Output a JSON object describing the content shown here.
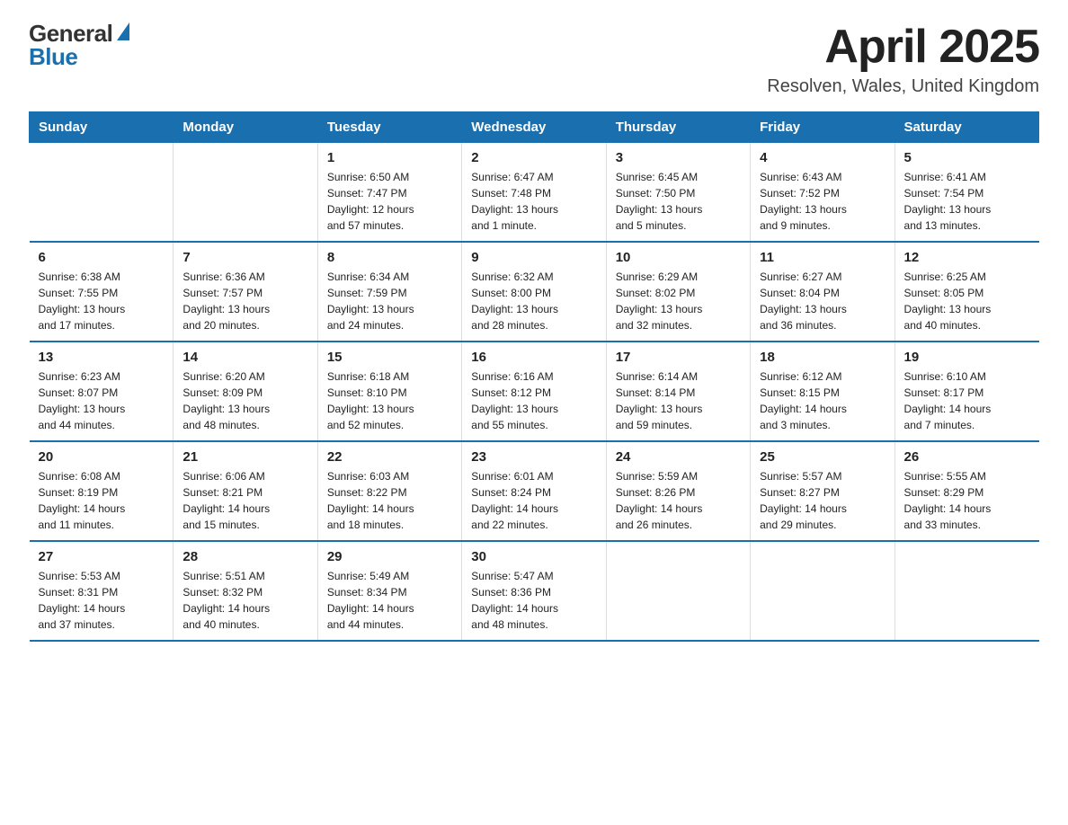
{
  "header": {
    "logo_general": "General",
    "logo_blue": "Blue",
    "month_title": "April 2025",
    "location": "Resolven, Wales, United Kingdom"
  },
  "weekdays": [
    "Sunday",
    "Monday",
    "Tuesday",
    "Wednesday",
    "Thursday",
    "Friday",
    "Saturday"
  ],
  "weeks": [
    [
      {
        "day": "",
        "info": ""
      },
      {
        "day": "",
        "info": ""
      },
      {
        "day": "1",
        "info": "Sunrise: 6:50 AM\nSunset: 7:47 PM\nDaylight: 12 hours\nand 57 minutes."
      },
      {
        "day": "2",
        "info": "Sunrise: 6:47 AM\nSunset: 7:48 PM\nDaylight: 13 hours\nand 1 minute."
      },
      {
        "day": "3",
        "info": "Sunrise: 6:45 AM\nSunset: 7:50 PM\nDaylight: 13 hours\nand 5 minutes."
      },
      {
        "day": "4",
        "info": "Sunrise: 6:43 AM\nSunset: 7:52 PM\nDaylight: 13 hours\nand 9 minutes."
      },
      {
        "day": "5",
        "info": "Sunrise: 6:41 AM\nSunset: 7:54 PM\nDaylight: 13 hours\nand 13 minutes."
      }
    ],
    [
      {
        "day": "6",
        "info": "Sunrise: 6:38 AM\nSunset: 7:55 PM\nDaylight: 13 hours\nand 17 minutes."
      },
      {
        "day": "7",
        "info": "Sunrise: 6:36 AM\nSunset: 7:57 PM\nDaylight: 13 hours\nand 20 minutes."
      },
      {
        "day": "8",
        "info": "Sunrise: 6:34 AM\nSunset: 7:59 PM\nDaylight: 13 hours\nand 24 minutes."
      },
      {
        "day": "9",
        "info": "Sunrise: 6:32 AM\nSunset: 8:00 PM\nDaylight: 13 hours\nand 28 minutes."
      },
      {
        "day": "10",
        "info": "Sunrise: 6:29 AM\nSunset: 8:02 PM\nDaylight: 13 hours\nand 32 minutes."
      },
      {
        "day": "11",
        "info": "Sunrise: 6:27 AM\nSunset: 8:04 PM\nDaylight: 13 hours\nand 36 minutes."
      },
      {
        "day": "12",
        "info": "Sunrise: 6:25 AM\nSunset: 8:05 PM\nDaylight: 13 hours\nand 40 minutes."
      }
    ],
    [
      {
        "day": "13",
        "info": "Sunrise: 6:23 AM\nSunset: 8:07 PM\nDaylight: 13 hours\nand 44 minutes."
      },
      {
        "day": "14",
        "info": "Sunrise: 6:20 AM\nSunset: 8:09 PM\nDaylight: 13 hours\nand 48 minutes."
      },
      {
        "day": "15",
        "info": "Sunrise: 6:18 AM\nSunset: 8:10 PM\nDaylight: 13 hours\nand 52 minutes."
      },
      {
        "day": "16",
        "info": "Sunrise: 6:16 AM\nSunset: 8:12 PM\nDaylight: 13 hours\nand 55 minutes."
      },
      {
        "day": "17",
        "info": "Sunrise: 6:14 AM\nSunset: 8:14 PM\nDaylight: 13 hours\nand 59 minutes."
      },
      {
        "day": "18",
        "info": "Sunrise: 6:12 AM\nSunset: 8:15 PM\nDaylight: 14 hours\nand 3 minutes."
      },
      {
        "day": "19",
        "info": "Sunrise: 6:10 AM\nSunset: 8:17 PM\nDaylight: 14 hours\nand 7 minutes."
      }
    ],
    [
      {
        "day": "20",
        "info": "Sunrise: 6:08 AM\nSunset: 8:19 PM\nDaylight: 14 hours\nand 11 minutes."
      },
      {
        "day": "21",
        "info": "Sunrise: 6:06 AM\nSunset: 8:21 PM\nDaylight: 14 hours\nand 15 minutes."
      },
      {
        "day": "22",
        "info": "Sunrise: 6:03 AM\nSunset: 8:22 PM\nDaylight: 14 hours\nand 18 minutes."
      },
      {
        "day": "23",
        "info": "Sunrise: 6:01 AM\nSunset: 8:24 PM\nDaylight: 14 hours\nand 22 minutes."
      },
      {
        "day": "24",
        "info": "Sunrise: 5:59 AM\nSunset: 8:26 PM\nDaylight: 14 hours\nand 26 minutes."
      },
      {
        "day": "25",
        "info": "Sunrise: 5:57 AM\nSunset: 8:27 PM\nDaylight: 14 hours\nand 29 minutes."
      },
      {
        "day": "26",
        "info": "Sunrise: 5:55 AM\nSunset: 8:29 PM\nDaylight: 14 hours\nand 33 minutes."
      }
    ],
    [
      {
        "day": "27",
        "info": "Sunrise: 5:53 AM\nSunset: 8:31 PM\nDaylight: 14 hours\nand 37 minutes."
      },
      {
        "day": "28",
        "info": "Sunrise: 5:51 AM\nSunset: 8:32 PM\nDaylight: 14 hours\nand 40 minutes."
      },
      {
        "day": "29",
        "info": "Sunrise: 5:49 AM\nSunset: 8:34 PM\nDaylight: 14 hours\nand 44 minutes."
      },
      {
        "day": "30",
        "info": "Sunrise: 5:47 AM\nSunset: 8:36 PM\nDaylight: 14 hours\nand 48 minutes."
      },
      {
        "day": "",
        "info": ""
      },
      {
        "day": "",
        "info": ""
      },
      {
        "day": "",
        "info": ""
      }
    ]
  ]
}
